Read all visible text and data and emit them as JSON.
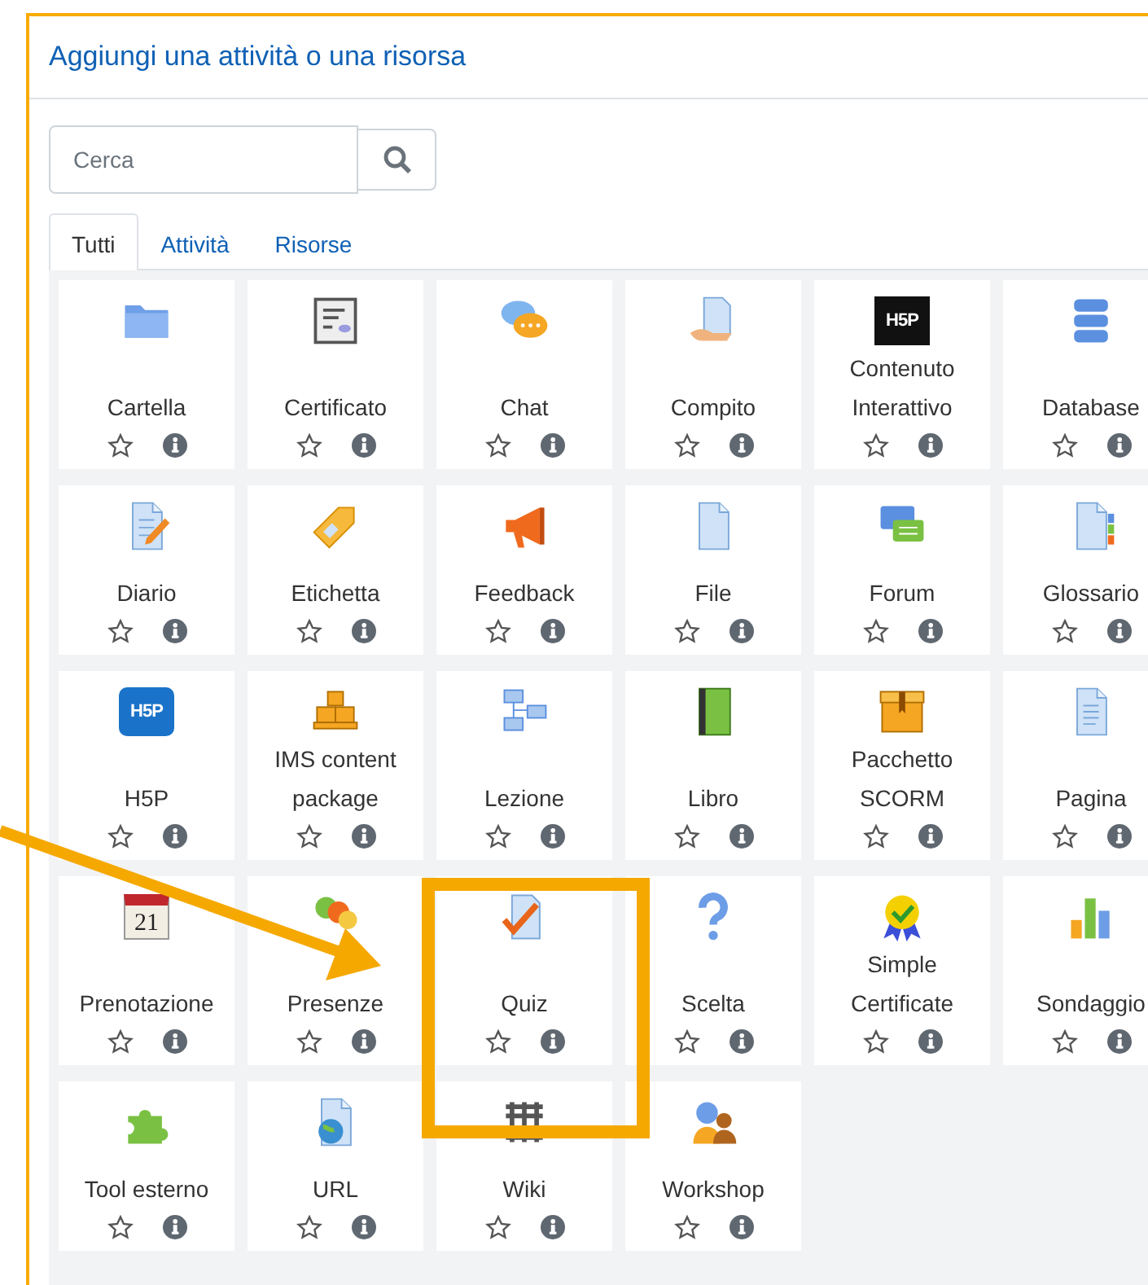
{
  "dialog": {
    "title": "Aggiungi una attività o una risorsa"
  },
  "search": {
    "placeholder": "Cerca"
  },
  "tabs": [
    {
      "label": "Tutti",
      "selected": true
    },
    {
      "label": "Attività",
      "selected": false
    },
    {
      "label": "Risorse",
      "selected": false
    }
  ],
  "tiles": [
    {
      "label": "Cartella"
    },
    {
      "label": "Certificato"
    },
    {
      "label": "Chat"
    },
    {
      "label": "Compito"
    },
    {
      "label": "Contenuto Interattivo",
      "icon_text": "H5P"
    },
    {
      "label": "Database"
    },
    {
      "label": "Diario"
    },
    {
      "label": "Etichetta"
    },
    {
      "label": "Feedback"
    },
    {
      "label": "File"
    },
    {
      "label": "Forum"
    },
    {
      "label": "Glossario"
    },
    {
      "label": "H5P",
      "icon_text": "H5P"
    },
    {
      "label": "IMS content package"
    },
    {
      "label": "Lezione"
    },
    {
      "label": "Libro"
    },
    {
      "label": "Pacchetto SCORM"
    },
    {
      "label": "Pagina"
    },
    {
      "label": "Prenotazione",
      "icon_text": "21"
    },
    {
      "label": "Presenze"
    },
    {
      "label": "Quiz"
    },
    {
      "label": "Scelta"
    },
    {
      "label": "Simple Certificate"
    },
    {
      "label": "Sondaggio"
    },
    {
      "label": "Tool esterno"
    },
    {
      "label": "URL"
    },
    {
      "label": "Wiki"
    },
    {
      "label": "Workshop"
    }
  ]
}
